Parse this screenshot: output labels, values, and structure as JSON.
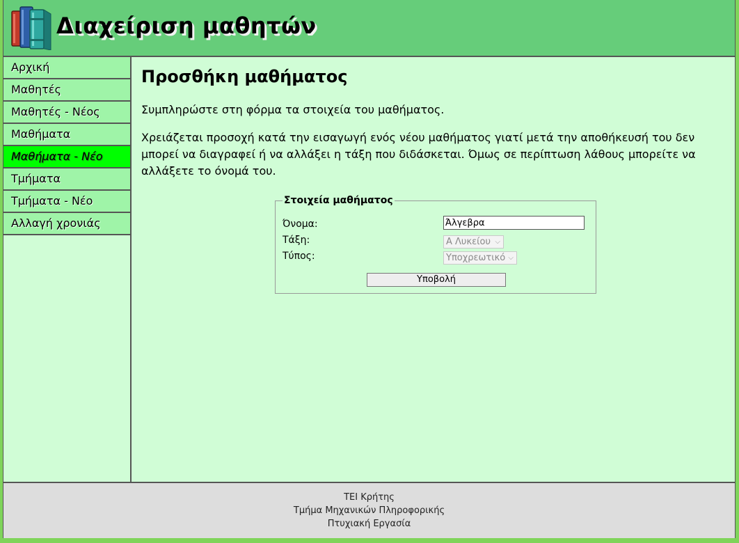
{
  "header": {
    "title": "Διαχείριση μαθητών",
    "logo_icon": "books-icon"
  },
  "sidebar": {
    "items": [
      {
        "label": "Αρχική",
        "active": false
      },
      {
        "label": "Μαθητές",
        "active": false
      },
      {
        "label": "Μαθητές - Νέος",
        "active": false
      },
      {
        "label": "Μαθήματα",
        "active": false
      },
      {
        "label": "Μαθήματα - Νέο",
        "active": true
      },
      {
        "label": "Τμήματα",
        "active": false
      },
      {
        "label": "Τμήματα - Νέο",
        "active": false
      },
      {
        "label": "Αλλαγή χρονιάς",
        "active": false
      }
    ]
  },
  "main": {
    "title": "Προσθήκη μαθήματος",
    "paragraph1": "Συμπληρώστε στη φόρμα τα στοιχεία του μαθήματος.",
    "paragraph2": "Χρειάζεται προσοχή κατά την εισαγωγή ενός νέου μαθήματος γιατί μετά την αποθήκευσή του δεν μπορεί να διαγραφεί ή να αλλάξει η τάξη που διδάσκεται. Όμως σε περίπτωση λάθους μπορείτε να αλλάξετε το όνομά του."
  },
  "form": {
    "legend": "Στοιχεία μαθήματος",
    "name_label": "Όνομα:",
    "name_value": "Άλγεβρα",
    "class_label": "Τάξη:",
    "class_value": "Α Λυκείου",
    "type_label": "Τύπος:",
    "type_value": "Υποχρεωτικό",
    "submit_label": "Υποβολή"
  },
  "footer": {
    "line1": "ΤΕΙ Κρήτης",
    "line2": "Τμήμα Μηχανικών Πληροφορικής",
    "line3": "Πτυχιακή Εργασία"
  },
  "colors": {
    "header_bg": "#66cd7a",
    "nav_bg": "#9ff4a8",
    "nav_active_bg": "#00ff00",
    "content_bg": "#d0fdd6",
    "footer_bg": "#dddddd"
  }
}
